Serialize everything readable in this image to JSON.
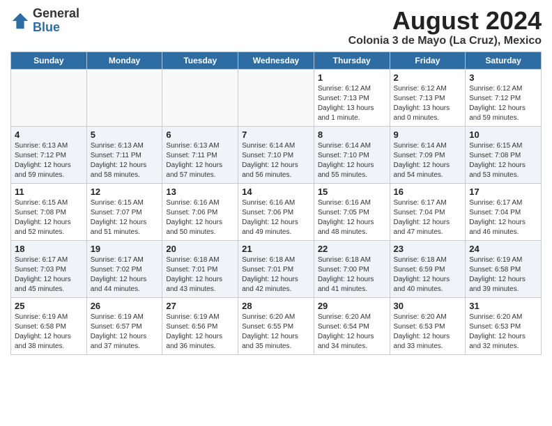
{
  "header": {
    "logo_general": "General",
    "logo_blue": "Blue",
    "title": "August 2024",
    "subtitle": "Colonia 3 de Mayo (La Cruz), Mexico"
  },
  "calendar": {
    "days_of_week": [
      "Sunday",
      "Monday",
      "Tuesday",
      "Wednesday",
      "Thursday",
      "Friday",
      "Saturday"
    ],
    "weeks": [
      [
        {
          "day": "",
          "info": ""
        },
        {
          "day": "",
          "info": ""
        },
        {
          "day": "",
          "info": ""
        },
        {
          "day": "",
          "info": ""
        },
        {
          "day": "1",
          "info": "Sunrise: 6:12 AM\nSunset: 7:13 PM\nDaylight: 13 hours and 1 minute."
        },
        {
          "day": "2",
          "info": "Sunrise: 6:12 AM\nSunset: 7:13 PM\nDaylight: 13 hours and 0 minutes."
        },
        {
          "day": "3",
          "info": "Sunrise: 6:12 AM\nSunset: 7:12 PM\nDaylight: 12 hours and 59 minutes."
        }
      ],
      [
        {
          "day": "4",
          "info": "Sunrise: 6:13 AM\nSunset: 7:12 PM\nDaylight: 12 hours and 59 minutes."
        },
        {
          "day": "5",
          "info": "Sunrise: 6:13 AM\nSunset: 7:11 PM\nDaylight: 12 hours and 58 minutes."
        },
        {
          "day": "6",
          "info": "Sunrise: 6:13 AM\nSunset: 7:11 PM\nDaylight: 12 hours and 57 minutes."
        },
        {
          "day": "7",
          "info": "Sunrise: 6:14 AM\nSunset: 7:10 PM\nDaylight: 12 hours and 56 minutes."
        },
        {
          "day": "8",
          "info": "Sunrise: 6:14 AM\nSunset: 7:10 PM\nDaylight: 12 hours and 55 minutes."
        },
        {
          "day": "9",
          "info": "Sunrise: 6:14 AM\nSunset: 7:09 PM\nDaylight: 12 hours and 54 minutes."
        },
        {
          "day": "10",
          "info": "Sunrise: 6:15 AM\nSunset: 7:08 PM\nDaylight: 12 hours and 53 minutes."
        }
      ],
      [
        {
          "day": "11",
          "info": "Sunrise: 6:15 AM\nSunset: 7:08 PM\nDaylight: 12 hours and 52 minutes."
        },
        {
          "day": "12",
          "info": "Sunrise: 6:15 AM\nSunset: 7:07 PM\nDaylight: 12 hours and 51 minutes."
        },
        {
          "day": "13",
          "info": "Sunrise: 6:16 AM\nSunset: 7:06 PM\nDaylight: 12 hours and 50 minutes."
        },
        {
          "day": "14",
          "info": "Sunrise: 6:16 AM\nSunset: 7:06 PM\nDaylight: 12 hours and 49 minutes."
        },
        {
          "day": "15",
          "info": "Sunrise: 6:16 AM\nSunset: 7:05 PM\nDaylight: 12 hours and 48 minutes."
        },
        {
          "day": "16",
          "info": "Sunrise: 6:17 AM\nSunset: 7:04 PM\nDaylight: 12 hours and 47 minutes."
        },
        {
          "day": "17",
          "info": "Sunrise: 6:17 AM\nSunset: 7:04 PM\nDaylight: 12 hours and 46 minutes."
        }
      ],
      [
        {
          "day": "18",
          "info": "Sunrise: 6:17 AM\nSunset: 7:03 PM\nDaylight: 12 hours and 45 minutes."
        },
        {
          "day": "19",
          "info": "Sunrise: 6:17 AM\nSunset: 7:02 PM\nDaylight: 12 hours and 44 minutes."
        },
        {
          "day": "20",
          "info": "Sunrise: 6:18 AM\nSunset: 7:01 PM\nDaylight: 12 hours and 43 minutes."
        },
        {
          "day": "21",
          "info": "Sunrise: 6:18 AM\nSunset: 7:01 PM\nDaylight: 12 hours and 42 minutes."
        },
        {
          "day": "22",
          "info": "Sunrise: 6:18 AM\nSunset: 7:00 PM\nDaylight: 12 hours and 41 minutes."
        },
        {
          "day": "23",
          "info": "Sunrise: 6:18 AM\nSunset: 6:59 PM\nDaylight: 12 hours and 40 minutes."
        },
        {
          "day": "24",
          "info": "Sunrise: 6:19 AM\nSunset: 6:58 PM\nDaylight: 12 hours and 39 minutes."
        }
      ],
      [
        {
          "day": "25",
          "info": "Sunrise: 6:19 AM\nSunset: 6:58 PM\nDaylight: 12 hours and 38 minutes."
        },
        {
          "day": "26",
          "info": "Sunrise: 6:19 AM\nSunset: 6:57 PM\nDaylight: 12 hours and 37 minutes."
        },
        {
          "day": "27",
          "info": "Sunrise: 6:19 AM\nSunset: 6:56 PM\nDaylight: 12 hours and 36 minutes."
        },
        {
          "day": "28",
          "info": "Sunrise: 6:20 AM\nSunset: 6:55 PM\nDaylight: 12 hours and 35 minutes."
        },
        {
          "day": "29",
          "info": "Sunrise: 6:20 AM\nSunset: 6:54 PM\nDaylight: 12 hours and 34 minutes."
        },
        {
          "day": "30",
          "info": "Sunrise: 6:20 AM\nSunset: 6:53 PM\nDaylight: 12 hours and 33 minutes."
        },
        {
          "day": "31",
          "info": "Sunrise: 6:20 AM\nSunset: 6:53 PM\nDaylight: 12 hours and 32 minutes."
        }
      ]
    ]
  }
}
